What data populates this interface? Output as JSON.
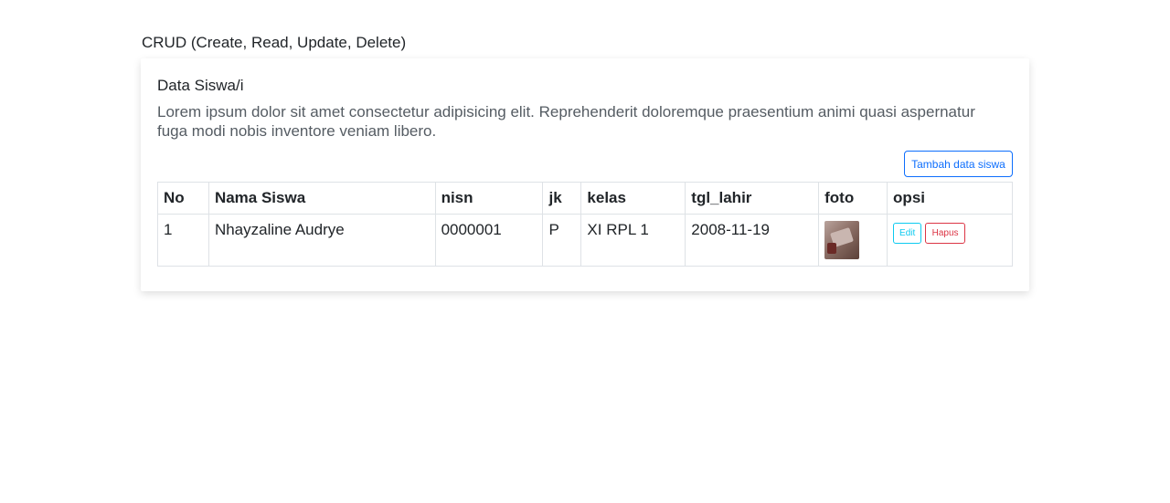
{
  "page": {
    "heading": "CRUD (Create, Read, Update, Delete)"
  },
  "card": {
    "title": "Data Siswa/i",
    "description": "Lorem ipsum dolor sit amet consectetur adipisicing elit. Reprehenderit doloremque praesentium animi quasi aspernatur fuga modi nobis inventore veniam libero.",
    "add_button": "Tambah data siswa"
  },
  "table": {
    "columns": [
      "No",
      "Nama Siswa",
      "nisn",
      "jk",
      "kelas",
      "tgl_lahir",
      "foto",
      "opsi"
    ],
    "rows": [
      {
        "no": "1",
        "nama": "Nhayzaline Audrye",
        "nisn": "0000001",
        "jk": "P",
        "kelas": "XI RPL 1",
        "tgl_lahir": "2008-11-19",
        "edit_label": "Edit",
        "delete_label": "Hapus"
      }
    ]
  },
  "colors": {
    "primary": "#0d6efd",
    "info": "#0dcaf0",
    "danger": "#dc3545"
  }
}
